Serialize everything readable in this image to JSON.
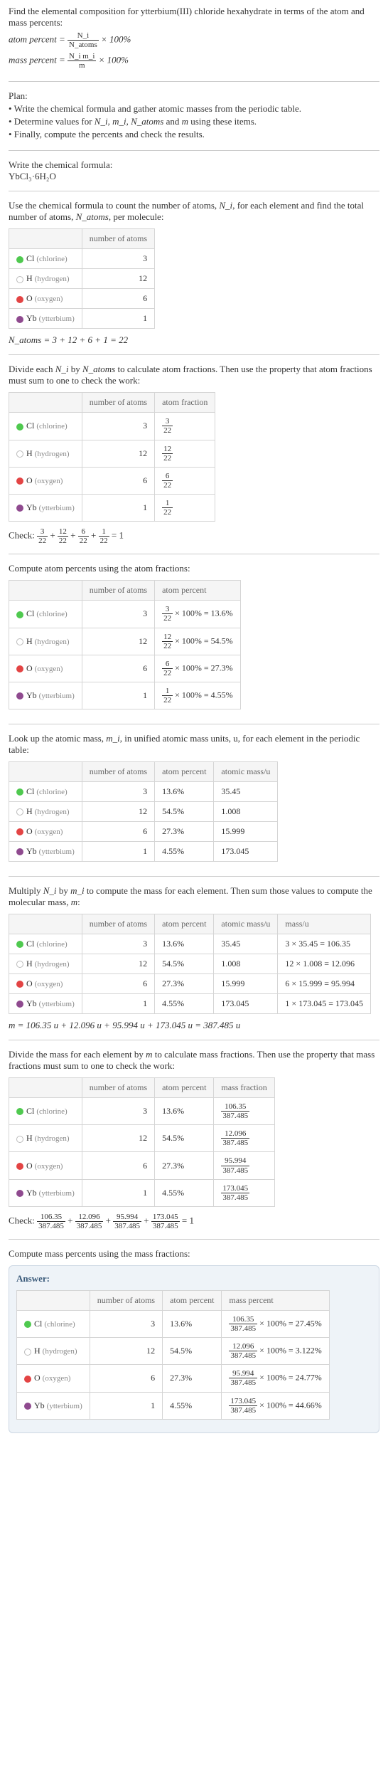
{
  "intro": {
    "question": "Find the elemental composition for ytterbium(III) chloride hexahydrate in terms of the atom and mass percents:",
    "eq1_lhs": "atom percent =",
    "eq1_num": "N_i",
    "eq1_den": "N_atoms",
    "eq1_tail": "× 100%",
    "eq2_lhs": "mass percent =",
    "eq2_num": "N_i m_i",
    "eq2_den": "m",
    "eq2_tail": "× 100%"
  },
  "plan": {
    "heading": "Plan:",
    "b1": "• Write the chemical formula and gather atomic masses from the periodic table.",
    "b2_a": "• Determine values for ",
    "b2_b": "N_i, m_i, N_atoms",
    "b2_c": " and ",
    "b2_d": "m",
    "b2_e": " using these items.",
    "b3": "• Finally, compute the percents and check the results."
  },
  "formula_section": {
    "heading": "Write the chemical formula:",
    "formula": "YbCl₃·6H₂O"
  },
  "count_section": {
    "text_a": "Use the chemical formula to count the number of atoms, ",
    "text_b": "N_i",
    "text_c": ", for each element and find the total number of atoms, ",
    "text_d": "N_atoms",
    "text_e": ", per molecule:",
    "col_atoms": "number of atoms",
    "equation": "N_atoms = 3 + 12 + 6 + 1 = 22"
  },
  "elements": {
    "cl": {
      "sym": "Cl",
      "name": "(chlorine)",
      "atoms": "3"
    },
    "h": {
      "sym": "H",
      "name": "(hydrogen)",
      "atoms": "12"
    },
    "o": {
      "sym": "O",
      "name": "(oxygen)",
      "atoms": "6"
    },
    "yb": {
      "sym": "Yb",
      "name": "(ytterbium)",
      "atoms": "1"
    }
  },
  "atomfrac_section": {
    "text_a": "Divide each ",
    "text_b": "N_i",
    "text_c": " by ",
    "text_d": "N_atoms",
    "text_e": " to calculate atom fractions. Then use the property that atom fractions must sum to one to check the work:",
    "col_frac": "atom fraction",
    "cl_n": "3",
    "cl_d": "22",
    "h_n": "12",
    "h_d": "22",
    "o_n": "6",
    "o_d": "22",
    "yb_n": "1",
    "yb_d": "22",
    "check_label": "Check: ",
    "check_tail": " = 1"
  },
  "atompct_section": {
    "text": "Compute atom percents using the atom fractions:",
    "col_pct": "atom percent",
    "cl_n": "3",
    "cl_d": "22",
    "cl_res": "× 100% = 13.6%",
    "h_n": "12",
    "h_d": "22",
    "h_res": "× 100% = 54.5%",
    "o_n": "6",
    "o_d": "22",
    "o_res": "× 100% = 27.3%",
    "yb_n": "1",
    "yb_d": "22",
    "yb_res": "× 100% = 4.55%"
  },
  "atomic_mass_section": {
    "text_a": "Look up the atomic mass, ",
    "text_b": "m_i",
    "text_c": ", in unified atomic mass units, u, for each element in the periodic table:",
    "col_mass": "atomic mass/u",
    "cl_pct": "13.6%",
    "cl_mass": "35.45",
    "h_pct": "54.5%",
    "h_mass": "1.008",
    "o_pct": "27.3%",
    "o_mass": "15.999",
    "yb_pct": "4.55%",
    "yb_mass": "173.045"
  },
  "molmass_section": {
    "text_a": "Multiply ",
    "text_b": "N_i",
    "text_c": " by ",
    "text_d": "m_i",
    "text_e": " to compute the mass for each element. Then sum those values to compute the molecular mass, ",
    "text_f": "m",
    "text_g": ":",
    "col_massu": "mass/u",
    "cl_calc": "3 × 35.45 = 106.35",
    "h_calc": "12 × 1.008 = 12.096",
    "o_calc": "6 × 15.999 = 95.994",
    "yb_calc": "1 × 173.045 = 173.045",
    "equation": "m = 106.35 u + 12.096 u + 95.994 u + 173.045 u = 387.485 u"
  },
  "massfrac_section": {
    "text_a": "Divide the mass for each element by ",
    "text_b": "m",
    "text_c": " to calculate mass fractions. Then use the property that mass fractions must sum to one to check the work:",
    "col_frac": "mass fraction",
    "cl_n": "106.35",
    "cl_d": "387.485",
    "h_n": "12.096",
    "h_d": "387.485",
    "o_n": "95.994",
    "o_d": "387.485",
    "yb_n": "173.045",
    "yb_d": "387.485",
    "check_label": "Check: ",
    "check_tail": " = 1"
  },
  "masspct_section": {
    "text": "Compute mass percents using the mass fractions:"
  },
  "answer": {
    "label": "Answer:",
    "col_masspct": "mass percent",
    "cl_n": "106.35",
    "cl_d": "387.485",
    "cl_res": "× 100% = 27.45%",
    "h_n": "12.096",
    "h_d": "387.485",
    "h_res": "× 100% = 3.122%",
    "o_n": "95.994",
    "o_d": "387.485",
    "o_res": "× 100% = 24.77%",
    "yb_n": "173.045",
    "yb_d": "387.485",
    "yb_res": "× 100% = 44.66%"
  },
  "chart_data": {
    "type": "table",
    "title": "Elemental composition of YbCl3·6H2O",
    "elements": [
      "Cl",
      "H",
      "O",
      "Yb"
    ],
    "number_of_atoms": [
      3,
      12,
      6,
      1
    ],
    "total_atoms": 22,
    "atom_percent": [
      13.6,
      54.5,
      27.3,
      4.55
    ],
    "atomic_mass_u": [
      35.45,
      1.008,
      15.999,
      173.045
    ],
    "mass_u": [
      106.35,
      12.096,
      95.994,
      173.045
    ],
    "molecular_mass_u": 387.485,
    "mass_percent": [
      27.45,
      3.122,
      24.77,
      44.66
    ]
  }
}
